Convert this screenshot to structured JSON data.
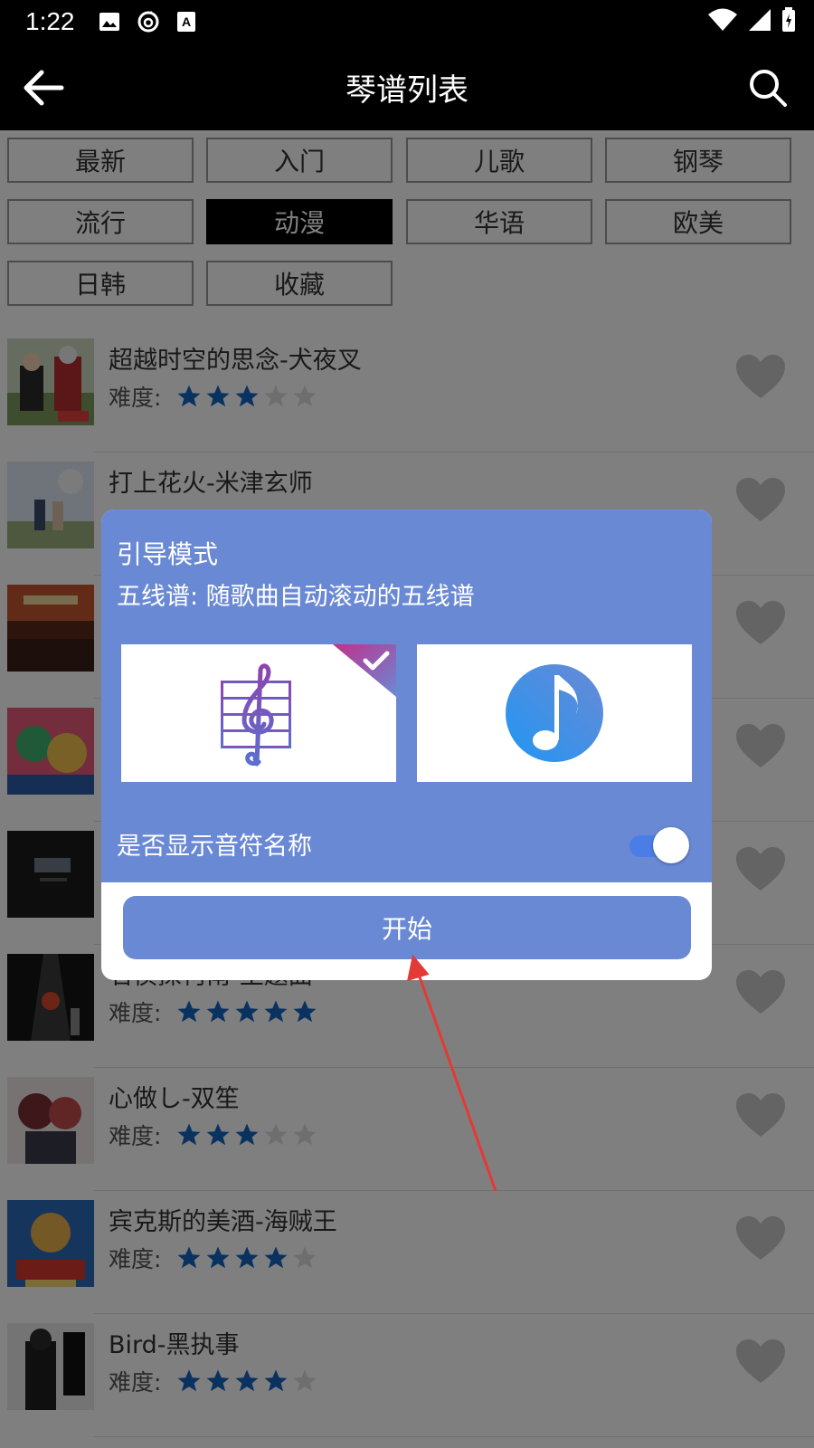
{
  "status_bar": {
    "time": "1:22",
    "icons_left": [
      "image-icon",
      "netease-music-icon",
      "font-icon"
    ],
    "icons_right": [
      "wifi-icon",
      "signal-icon",
      "battery-charging-icon"
    ]
  },
  "app_bar": {
    "title": "琴谱列表",
    "back_icon": "arrow-left-icon",
    "search_icon": "search-icon"
  },
  "categories": [
    {
      "label": "最新",
      "active": false
    },
    {
      "label": "入门",
      "active": false
    },
    {
      "label": "儿歌",
      "active": false
    },
    {
      "label": "钢琴",
      "active": false
    },
    {
      "label": "流行",
      "active": false
    },
    {
      "label": "动漫",
      "active": true
    },
    {
      "label": "华语",
      "active": false
    },
    {
      "label": "欧美",
      "active": false
    },
    {
      "label": "日韩",
      "active": false
    },
    {
      "label": "收藏",
      "active": false
    }
  ],
  "difficulty_label": "难度:",
  "songs": [
    {
      "title": "超越时空的思念-犬夜叉",
      "stars": 3
    },
    {
      "title": "打上花火-米津玄师",
      "stars": 0
    },
    {
      "title": "",
      "stars": 0
    },
    {
      "title": "",
      "stars": 0
    },
    {
      "title": "",
      "stars": 0
    },
    {
      "title": "名侦探柯南-主题曲",
      "stars": 5
    },
    {
      "title": "心做し-双笙",
      "stars": 3
    },
    {
      "title": "宾克斯的美酒-海贼王",
      "stars": 4
    },
    {
      "title": "Bird-黑执事",
      "stars": 4
    }
  ],
  "dialog": {
    "title": "引导模式",
    "subtitle": "五线谱: 随歌曲自动滚动的五线谱",
    "modes": [
      {
        "icon": "treble-clef-staff-icon",
        "selected": true
      },
      {
        "icon": "music-note-icon",
        "selected": false
      }
    ],
    "toggle_label": "是否显示音符名称",
    "toggle_on": true,
    "start_label": "开始"
  },
  "colors": {
    "dialog_blue": "#6a89d4",
    "star_blue": "#1565c0",
    "active_chip": "#000000",
    "arrow_red": "#e53935"
  }
}
